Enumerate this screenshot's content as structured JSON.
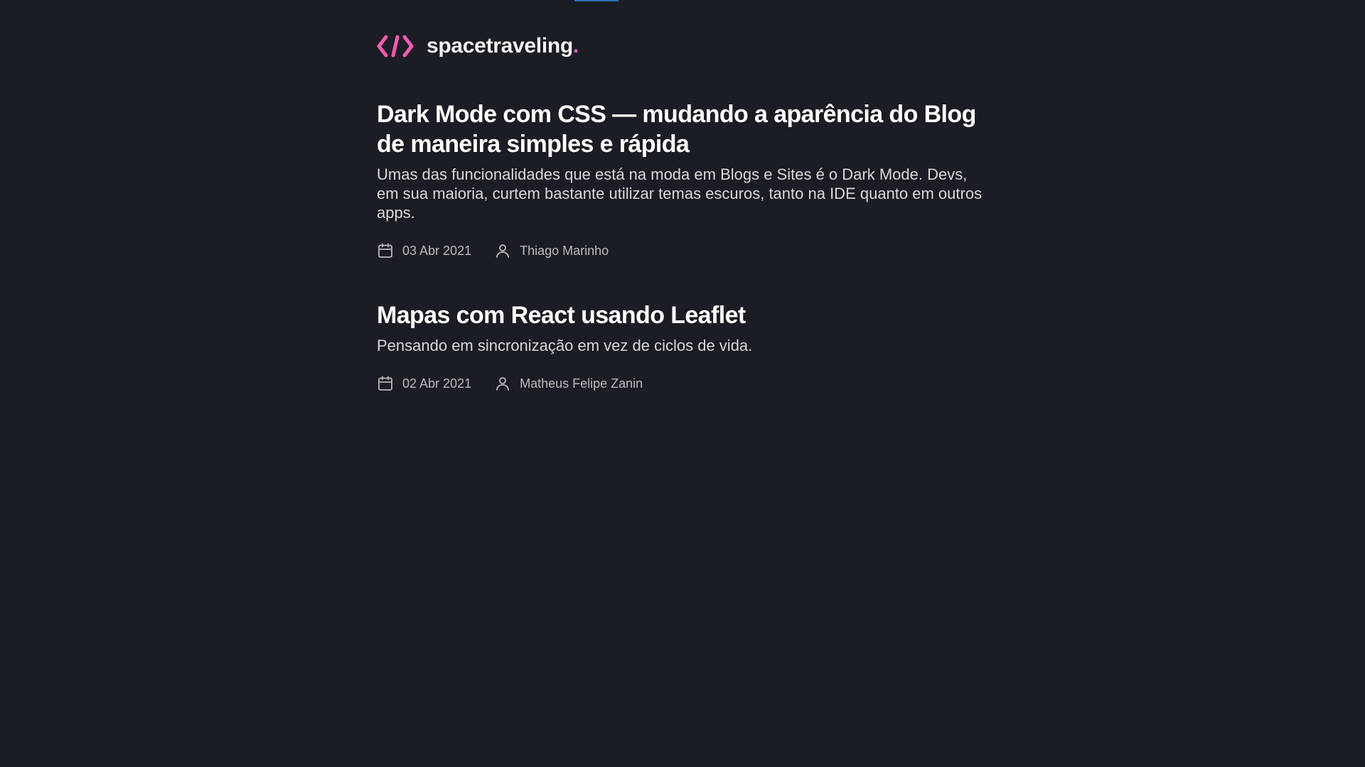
{
  "header": {
    "brand_name": "spacetraveling",
    "brand_dot": ".",
    "logo_icon": "code-brackets-icon",
    "accent_color": "#ff57b2"
  },
  "posts": [
    {
      "title": "Dark Mode com CSS — mudando a aparência do Blog de maneira simples e rápida",
      "subtitle": "Umas das funcionalidades que está na moda em Blogs e Sites é o Dark Mode. Devs, em sua maioria, curtem bastante utilizar temas escuros, tanto na IDE quanto em outros apps.",
      "date": "03 Abr 2021",
      "author": "Thiago Marinho"
    },
    {
      "title": "Mapas com React usando Leaflet",
      "subtitle": "Pensando em sincronização em vez de ciclos de vida.",
      "date": "02 Abr 2021",
      "author": "Matheus Felipe Zanin"
    }
  ],
  "icons": {
    "date": "calendar-icon",
    "author": "user-icon"
  }
}
